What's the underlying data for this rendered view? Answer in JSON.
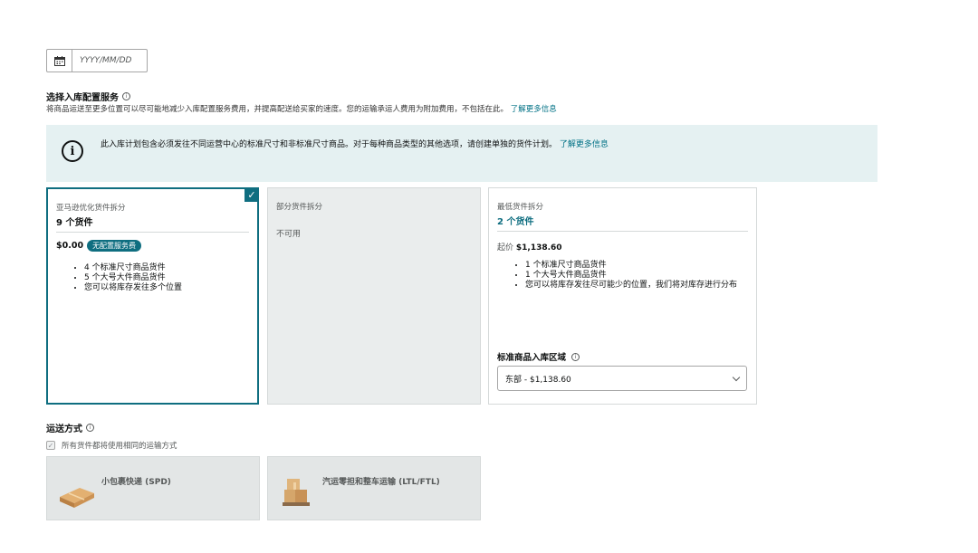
{
  "date": {
    "placeholder": "YYYY/MM/DD",
    "icon": "calendar-icon"
  },
  "placement": {
    "title": "选择入库配置服务",
    "description": "将商品运送至更多位置可以尽可能地减少入库配置服务费用，并提高配送给买家的速度。您的运输承运人费用为附加费用，不包括在此。",
    "learn_more": "了解更多信息"
  },
  "alert": {
    "message": "此入库计划包含必须发往不同运营中心的标准尺寸和非标准尺寸商品。对于每种商品类型的其他选项，请创建单独的货件计划。",
    "learn_more": "了解更多信息"
  },
  "options": [
    {
      "subtitle": "亚马逊优化货件拆分",
      "title": "9 个货件",
      "price": "$0.00",
      "badge": "无配置服务费",
      "bullets": [
        "4 个标准尺寸商品货件",
        "5 个大号大件商品货件",
        "您可以将库存发往多个位置"
      ],
      "selected": true
    },
    {
      "subtitle": "部分货件拆分",
      "status": "不可用",
      "selected": false
    },
    {
      "subtitle": "最低货件拆分",
      "title": "2 个货件",
      "from_label": "起价",
      "from_price": "$1,138.60",
      "bullets": [
        "1 个标准尺寸商品货件",
        "1 个大号大件商品货件",
        "您可以将库存发往尽可能少的位置，我们将对库存进行分布"
      ],
      "region_label": "标准商品入库区域",
      "region_value": "东部 - $1,138.60",
      "selected": false
    }
  ],
  "shipping": {
    "title": "运送方式",
    "same_method_label": "所有货件都将使用相同的运输方式",
    "methods": [
      {
        "label": "小包裹快递 (SPD)",
        "icon": "parcel-box-icon"
      },
      {
        "label": "汽运零担和整车运输 (LTL/FTL)",
        "icon": "pallet-boxes-icon"
      }
    ]
  },
  "colors": {
    "accent": "#0f6e80",
    "link": "#007185",
    "alert_bg": "#e5f1f2",
    "disabled_bg": "#eaeded"
  }
}
